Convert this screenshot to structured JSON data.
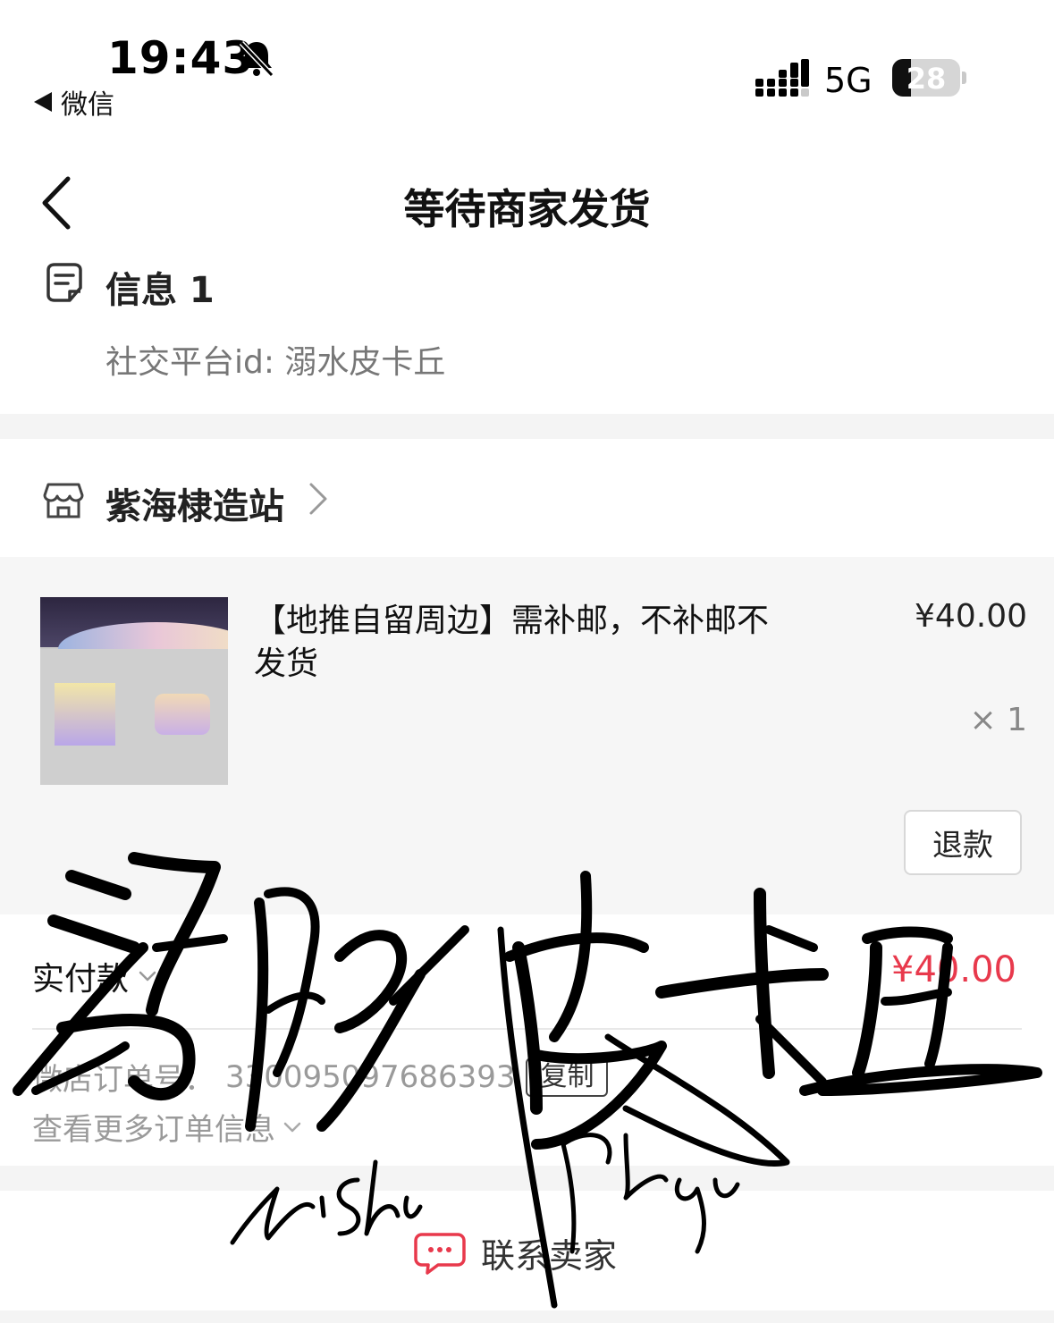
{
  "status_bar": {
    "time": "19:43",
    "back_app": "微信",
    "network": "5G",
    "battery_percent": "28",
    "battery_level": 0.28,
    "icons": [
      "bell-slash-icon",
      "signal-icon",
      "battery-icon"
    ]
  },
  "nav": {
    "title": "等待商家发货",
    "back_icon": "chevron-left-icon"
  },
  "message": {
    "title": "信息 1",
    "detail": "社交平台id: 溺水皮卡丘",
    "icon": "message-note-icon"
  },
  "shop": {
    "name": "紫海棣造站",
    "icon": "store-icon"
  },
  "product": {
    "title": "【地推自留周边】需补邮，不补邮不发货",
    "price": "¥40.00",
    "quantity": "× 1",
    "refund_label": "退款"
  },
  "payment": {
    "label": "实付款",
    "amount": "¥40.00",
    "order_label": "微店订单号：",
    "order_number": "330095097686393",
    "copy_label": "复制",
    "more_label": "查看更多订单信息"
  },
  "footer": {
    "contact_label": "联系卖家",
    "contact_icon": "chat-bubble-icon"
  },
  "signature": {
    "text": "溺水皮卡丘",
    "pinyin_1": "nishui",
    "pinyin_2": "pikaqiu"
  },
  "colors": {
    "accent_red": "#e8394c",
    "section_gray": "#f4f4f4",
    "text_gray": "#777777"
  }
}
